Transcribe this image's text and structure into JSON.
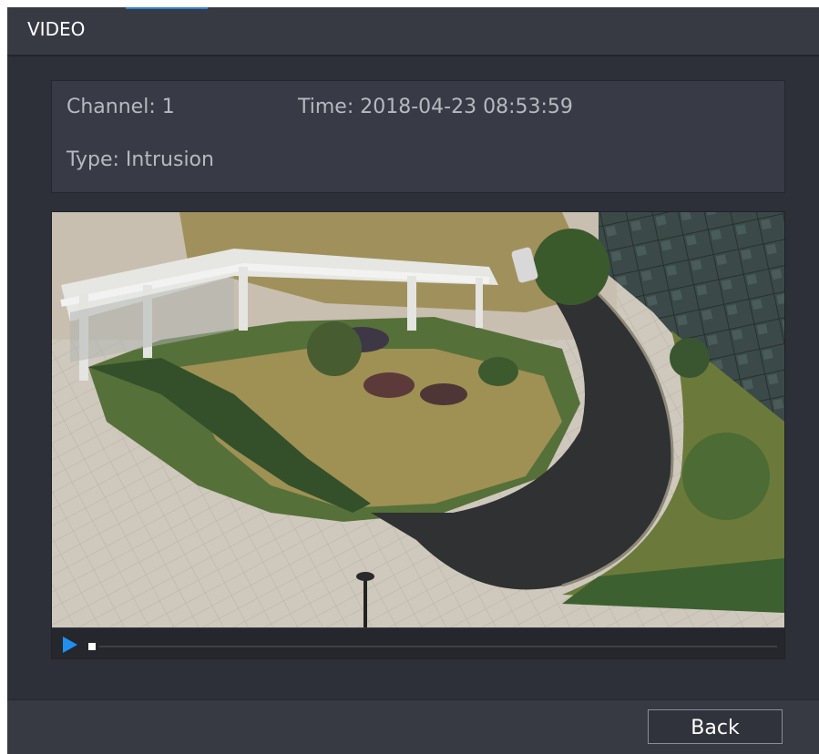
{
  "window": {
    "title": "VIDEO"
  },
  "info": {
    "channel": "Channel: 1",
    "time": "Time: 2018-04-23 08:53:59",
    "type": "Type: Intrusion"
  },
  "player": {
    "play_icon": "play-icon",
    "progress": 0.0
  },
  "footer": {
    "back_label": "Back"
  },
  "colors": {
    "background": "#2d3038",
    "panel": "#383b45",
    "accent": "#1e90f0",
    "text": "#b6b9c0"
  }
}
